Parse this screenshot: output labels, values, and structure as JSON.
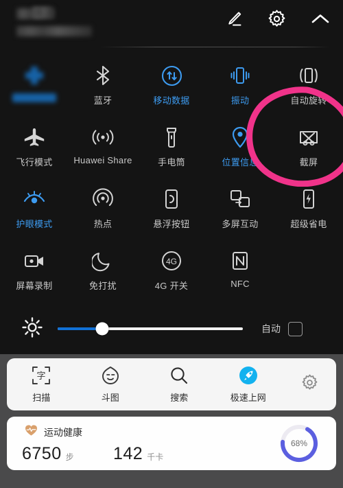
{
  "header": {
    "profile_line1": "",
    "profile_line2": "",
    "edit_icon": "pencil-edit-icon",
    "settings_icon": "gear-icon",
    "collapse_icon": "chevron-up-icon"
  },
  "quick_settings": {
    "tiles": [
      {
        "label": "",
        "icon": "wlan-icon",
        "state": "on",
        "blurred": true
      },
      {
        "label": "蓝牙",
        "icon": "bluetooth-icon",
        "state": "off",
        "blurred": false
      },
      {
        "label": "移动数据",
        "icon": "mobile-data-icon",
        "state": "on",
        "blurred": false
      },
      {
        "label": "振动",
        "icon": "vibrate-icon",
        "state": "on",
        "blurred": false
      },
      {
        "label": "自动旋转",
        "icon": "auto-rotate-icon",
        "state": "off",
        "blurred": false
      },
      {
        "label": "飞行模式",
        "icon": "airplane-icon",
        "state": "off",
        "blurred": false
      },
      {
        "label": "Huawei Share",
        "icon": "huawei-share-icon",
        "state": "off",
        "blurred": false
      },
      {
        "label": "手电筒",
        "icon": "flashlight-icon",
        "state": "off",
        "blurred": false
      },
      {
        "label": "位置信息",
        "icon": "location-pin-icon",
        "state": "on",
        "blurred": false
      },
      {
        "label": "截屏",
        "icon": "screenshot-scissors-icon",
        "state": "off",
        "blurred": false
      },
      {
        "label": "护眼模式",
        "icon": "eye-comfort-icon",
        "state": "on",
        "blurred": false
      },
      {
        "label": "热点",
        "icon": "hotspot-icon",
        "state": "off",
        "blurred": false
      },
      {
        "label": "悬浮按钮",
        "icon": "floating-button-icon",
        "state": "off",
        "blurred": false
      },
      {
        "label": "多屏互动",
        "icon": "multi-screen-icon",
        "state": "off",
        "blurred": false
      },
      {
        "label": "超级省电",
        "icon": "ultra-power-saving-icon",
        "state": "off",
        "blurred": false
      },
      {
        "label": "屏幕录制",
        "icon": "screen-record-icon",
        "state": "off",
        "blurred": false
      },
      {
        "label": "免打扰",
        "icon": "do-not-disturb-moon-icon",
        "state": "off",
        "blurred": false
      },
      {
        "label": "4G 开关",
        "icon": "four-g-toggle-icon",
        "state": "off",
        "blurred": false
      },
      {
        "label": "NFC",
        "icon": "nfc-icon",
        "state": "off",
        "blurred": false
      },
      {
        "label": "",
        "icon": "",
        "state": "empty",
        "blurred": false
      }
    ]
  },
  "brightness": {
    "sun_icon": "brightness-sun-icon",
    "value_percent": 24,
    "auto_label": "自动",
    "auto_checked": false
  },
  "app_bar": {
    "items": [
      {
        "label": "扫描",
        "icon": "scan-text-icon"
      },
      {
        "label": "斗图",
        "icon": "meme-face-icon"
      },
      {
        "label": "搜索",
        "icon": "search-icon"
      },
      {
        "label": "极速上网",
        "icon": "fast-internet-rocket-icon"
      }
    ],
    "settings_icon": "gear-icon"
  },
  "health_card": {
    "heart_icon": "heart-pulse-icon",
    "title": "运动健康",
    "steps_value": "6750",
    "steps_unit": "步",
    "calories_value": "142",
    "calories_unit": "千卡",
    "progress_percent": "68%",
    "progress_value": 68
  },
  "annotation": {
    "shape": "hand-drawn-circle",
    "color": "#f0338a",
    "targets": "截屏"
  },
  "colors": {
    "panel_bg": "#141414",
    "accent_on": "#3d9bf0",
    "slider_fill": "#1171d6",
    "card_bg": "#f5f5f5",
    "annotation_pink": "#f0338a",
    "ring_progress": "#5b5fe0"
  }
}
